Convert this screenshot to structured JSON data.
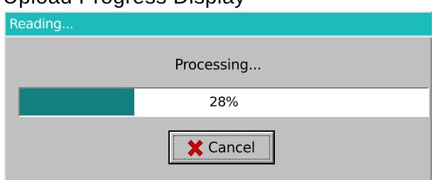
{
  "background_text": "Upload Progress Display",
  "dialog": {
    "title": "Reading...",
    "title_bar_color": "#1cbcbc",
    "status": "Processing...",
    "progress": {
      "value": 0.28,
      "label": "28%",
      "fill_color": "#128080"
    },
    "cancel_button": {
      "label": "Cancel",
      "icon": "red-x-icon"
    }
  }
}
